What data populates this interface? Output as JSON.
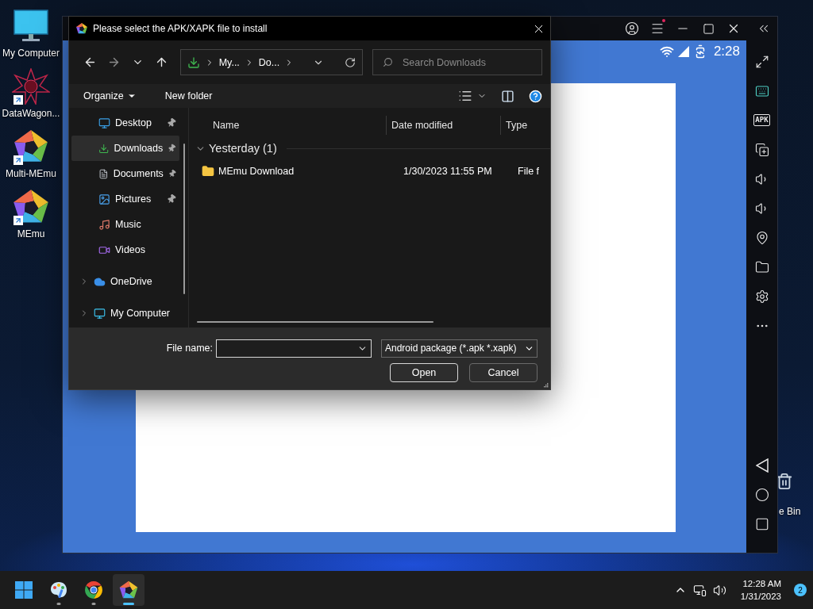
{
  "desktop": {
    "icons": [
      {
        "kind": "computer",
        "label": "My Computer",
        "shortcut": false
      },
      {
        "kind": "datawagon",
        "label": "DataWagon...",
        "shortcut": true
      },
      {
        "kind": "multimemu",
        "label": "Multi-MEmu",
        "shortcut": true
      },
      {
        "kind": "memu",
        "label": "MEmu",
        "shortcut": true
      }
    ],
    "recycle_bin": {
      "label": "e Bin"
    }
  },
  "emulator": {
    "menu_badge": true,
    "status_time": "2:28",
    "sidebar": [
      {
        "kind": "fullscreen"
      },
      {
        "kind": "keyboard"
      },
      {
        "kind": "apk",
        "label": "APK"
      },
      {
        "kind": "multi"
      },
      {
        "kind": "volume_up"
      },
      {
        "kind": "volume_down"
      },
      {
        "kind": "location"
      },
      {
        "kind": "folder"
      },
      {
        "kind": "settings"
      },
      {
        "kind": "more"
      }
    ],
    "nav_buttons": [
      {
        "kind": "back"
      },
      {
        "kind": "home"
      },
      {
        "kind": "recents"
      }
    ]
  },
  "dialog": {
    "title": "Please select the APK/XAPK file to install",
    "breadcrumb": [
      "My...",
      "Do..."
    ],
    "search": {
      "placeholder": "Search Downloads"
    },
    "toolbar": [
      "Organize",
      "New folder"
    ],
    "nav": {
      "quick_access": [
        {
          "kind": "desktop",
          "label": "Desktop",
          "pinned": true,
          "selected": false
        },
        {
          "kind": "download",
          "label": "Downloads",
          "pinned": true,
          "selected": true
        },
        {
          "kind": "document",
          "label": "Documents",
          "pinned": true,
          "selected": false
        },
        {
          "kind": "picture",
          "label": "Pictures",
          "pinned": true,
          "selected": false
        },
        {
          "kind": "music",
          "label": "Music",
          "pinned": false,
          "selected": false
        },
        {
          "kind": "video",
          "label": "Videos",
          "pinned": false,
          "selected": false
        }
      ],
      "locations": [
        {
          "kind": "cloud",
          "label": "OneDrive",
          "expanded": false,
          "selected": false
        },
        {
          "kind": "computer",
          "label": "My Computer",
          "expanded": false,
          "selected": false
        }
      ]
    },
    "columns": [
      "Name",
      "Date modified",
      "Type"
    ],
    "groups": [
      {
        "label": "Yesterday (1)",
        "expanded": true,
        "rows": [
          {
            "name": "MEmu Download",
            "date": "1/30/2023 11:55 PM",
            "type": "File f"
          }
        ]
      }
    ],
    "file_name_label": "File name:",
    "file_type": "Android package (*.apk *.xapk)",
    "buttons": [
      "Open",
      "Cancel"
    ]
  },
  "taskbar": {
    "apps": [
      {
        "kind": "start",
        "selected": false,
        "running": false
      },
      {
        "kind": "paint",
        "selected": false,
        "running": true
      },
      {
        "kind": "chrome",
        "selected": false,
        "running": true
      },
      {
        "kind": "memu",
        "selected": true,
        "running": true
      }
    ],
    "time": "12:28 AM",
    "date": "1/31/2023",
    "notification_count": "2"
  }
}
